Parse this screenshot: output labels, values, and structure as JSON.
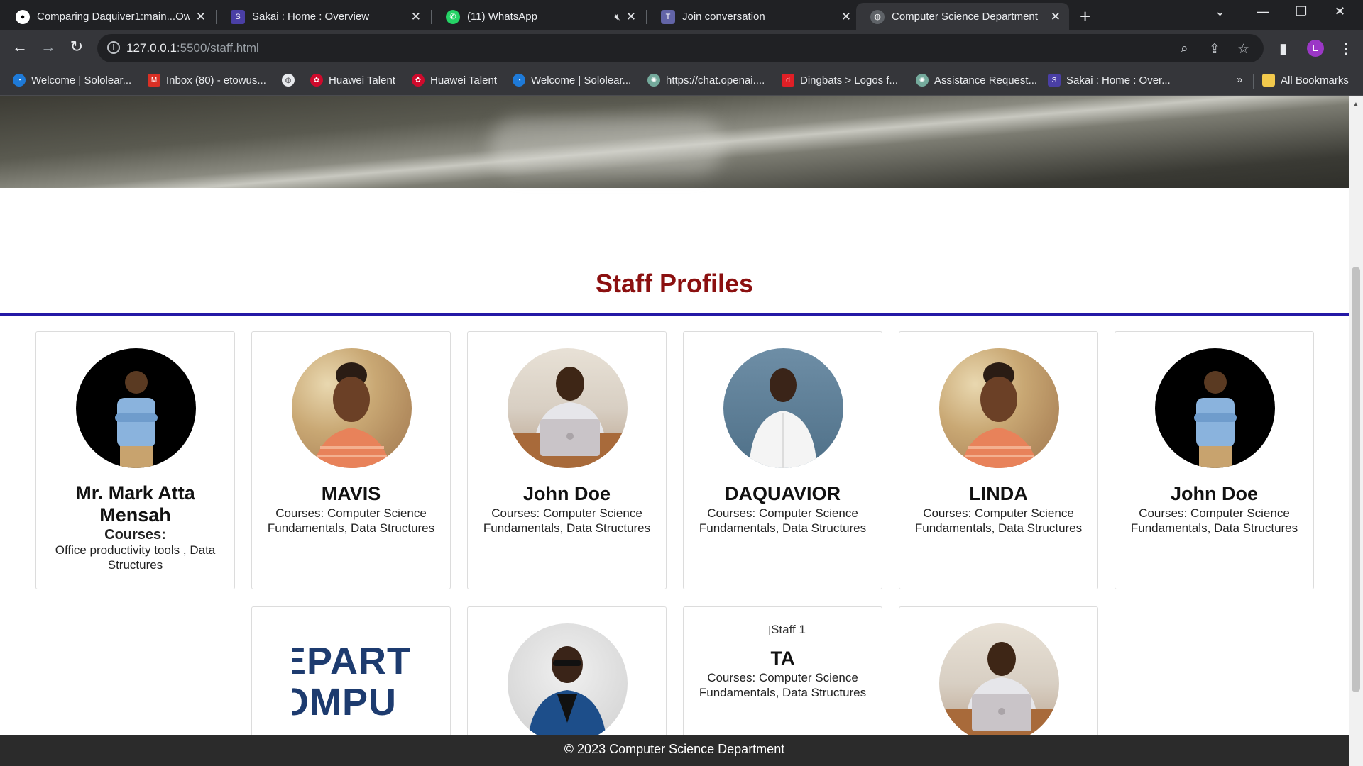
{
  "browser": {
    "tabs": [
      {
        "title": "Comparing Daquiver1:main...Ow",
        "icon": "github-icon",
        "color": "#ffffff"
      },
      {
        "title": "Sakai : Home : Overview",
        "icon": "sakai-icon",
        "color": "#4a3fa5"
      },
      {
        "title": "(11) WhatsApp",
        "icon": "whatsapp-icon",
        "color": "#25d366"
      },
      {
        "title": "Join conversation",
        "icon": "teams-icon",
        "color": "#6264a7"
      },
      {
        "title": "Computer Science Department",
        "icon": "globe-icon",
        "color": "#9aa0a6"
      }
    ],
    "url_host": "127.0.0.1",
    "url_path": ":5500/staff.html",
    "profile_initial": "E",
    "bookmarks": [
      {
        "label": "Welcome | Sololear...",
        "icon": "sololearn-icon"
      },
      {
        "label": "Inbox (80) - etowus...",
        "icon": "gmail-icon"
      },
      {
        "label": "",
        "icon": "globe-icon"
      },
      {
        "label": "Huawei Talent",
        "icon": "huawei-icon"
      },
      {
        "label": "Huawei Talent",
        "icon": "huawei-icon"
      },
      {
        "label": "Welcome | Sololear...",
        "icon": "sololearn-icon"
      },
      {
        "label": "https://chat.openai....",
        "icon": "openai-icon"
      },
      {
        "label": "Dingbats > Logos f...",
        "icon": "dingbats-icon"
      },
      {
        "label": "Assistance Request...",
        "icon": "openai-icon"
      },
      {
        "label": "Sakai : Home : Over...",
        "icon": "sakai-icon"
      }
    ],
    "overflow_label": "»",
    "all_bookmarks_label": "All Bookmarks"
  },
  "page": {
    "title": "Staff Profiles",
    "title_color": "#8b1010",
    "rule_color": "#2418a6",
    "staff": [
      {
        "name": "Mr. Mark Atta Mensah",
        "courses_heading": "Courses:",
        "courses": "Office productivity tools , Data Structures"
      },
      {
        "name": "MAVIS",
        "courses": "Courses: Computer Science Fundamentals, Data Structures"
      },
      {
        "name": "John Doe",
        "courses": "Courses: Computer Science Fundamentals, Data Structures"
      },
      {
        "name": "DAQUAVIOR",
        "courses": "Courses: Computer Science Fundamentals, Data Structures"
      },
      {
        "name": "LINDA",
        "courses": "Courses: Computer Science Fundamentals, Data Structures"
      },
      {
        "name": "John Doe",
        "courses": "Courses: Computer Science Fundamentals, Data Structures"
      }
    ],
    "row2": {
      "logo_text_top": "EPART",
      "logo_text_bottom": "OMPU",
      "broken_image_alt": "Staff 1",
      "ta_name": "TA",
      "ta_courses": "Courses: Computer Science Fundamentals, Data Structures"
    },
    "footer": "© 2023 Computer Science Department"
  }
}
